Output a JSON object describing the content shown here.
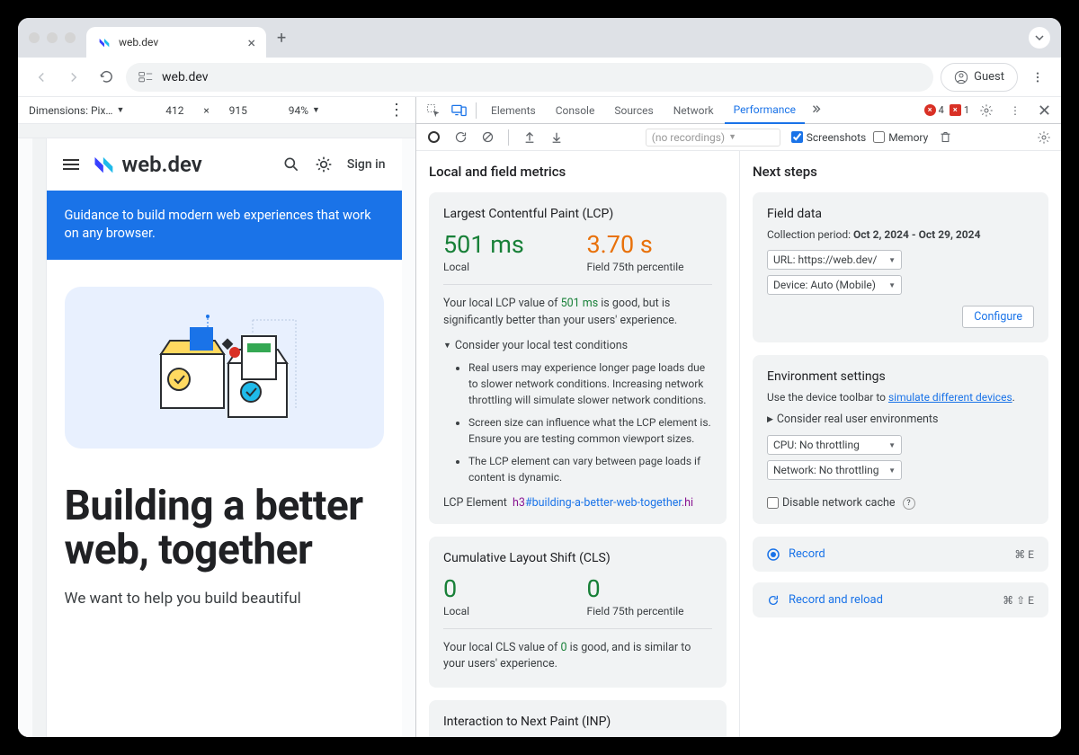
{
  "browser": {
    "tab_title": "web.dev",
    "address": "web.dev",
    "guest_label": "Guest"
  },
  "device_toolbar": {
    "dimensions_label": "Dimensions: Pix…",
    "width": "412",
    "height": "915",
    "zoom": "94%"
  },
  "webdev": {
    "logo_text": "web.dev",
    "sign_in": "Sign in",
    "banner": "Guidance to build modern web experiences that work on any browser.",
    "hero_title": "Building a better web, together",
    "hero_sub": "We want to help you build beautiful"
  },
  "devtools": {
    "tabs": [
      "Elements",
      "Console",
      "Sources",
      "Network",
      "Performance"
    ],
    "active_tab": "Performance",
    "errors_count": "4",
    "warnings_count": "1",
    "toolbar": {
      "recordings_placeholder": "(no recordings)",
      "screenshots_label": "Screenshots",
      "memory_label": "Memory"
    },
    "left_panel_title": "Local and field metrics",
    "lcp": {
      "name": "Largest Contentful Paint (LCP)",
      "local_value": "501 ms",
      "local_label": "Local",
      "field_value": "3.70 s",
      "field_label": "Field 75th percentile",
      "desc_pre": "Your local LCP value of ",
      "desc_val": "501 ms",
      "desc_post": " is good, but is significantly better than your users' experience.",
      "disclosure": "Consider your local test conditions",
      "bullets": [
        "Real users may experience longer page loads due to slower network conditions. Increasing network throttling will simulate slower network conditions.",
        "Screen size can influence what the LCP element is. Ensure you are testing common viewport sizes.",
        "The LCP element can vary between page loads if content is dynamic."
      ],
      "element_label": "LCP Element",
      "element_tag": "h3",
      "element_id": "#building-a-better-web-together",
      "element_cls": ".hi"
    },
    "cls": {
      "name": "Cumulative Layout Shift (CLS)",
      "local_value": "0",
      "local_label": "Local",
      "field_value": "0",
      "field_label": "Field 75th percentile",
      "desc_pre": "Your local CLS value of ",
      "desc_val": "0",
      "desc_post": " is good, and is similar to your users' experience."
    },
    "inp": {
      "name": "Interaction to Next Paint (INP)"
    },
    "right_panel_title": "Next steps",
    "field_data": {
      "heading": "Field data",
      "period_label": "Collection period: ",
      "period_value": "Oct 2, 2024 - Oct 29, 2024",
      "url_sel": "URL: https://web.dev/",
      "device_sel": "Device: Auto (Mobile)",
      "configure": "Configure"
    },
    "env": {
      "heading": "Environment settings",
      "hint_pre": "Use the device toolbar to ",
      "hint_link": "simulate different devices",
      "disclosure": "Consider real user environments",
      "cpu_sel": "CPU: No throttling",
      "net_sel": "Network: No throttling",
      "disable_cache": "Disable network cache"
    },
    "record_label": "Record",
    "record_shortcut": "⌘ E",
    "record_reload_label": "Record and reload",
    "record_reload_shortcut": "⌘ ⇧ E"
  }
}
